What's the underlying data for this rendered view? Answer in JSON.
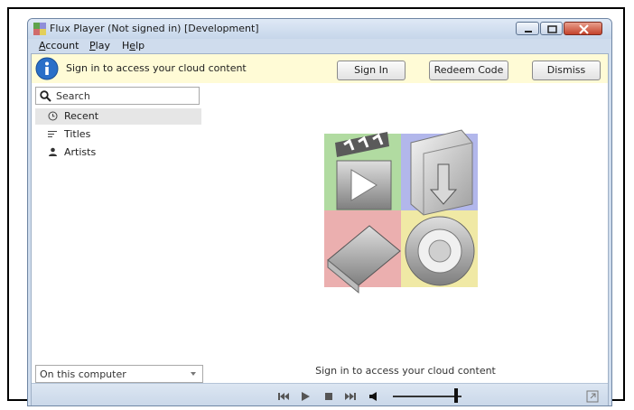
{
  "window": {
    "title": "Flux Player (Not signed in) [Development]"
  },
  "menu": {
    "items": [
      {
        "pre": "",
        "ul": "A",
        "post": "ccount"
      },
      {
        "pre": "",
        "ul": "P",
        "post": "lay"
      },
      {
        "pre": "H",
        "ul": "e",
        "post": "lp"
      }
    ]
  },
  "infobar": {
    "message": "Sign in to access your cloud content",
    "sign_in_label": "Sign In",
    "redeem_label": "Redeem Code",
    "dismiss_label": "Dismiss"
  },
  "sidebar": {
    "search_placeholder": "Search",
    "items": [
      {
        "label": "Recent",
        "icon": "clock-icon",
        "selected": true
      },
      {
        "label": "Titles",
        "icon": "list-icon",
        "selected": false
      },
      {
        "label": "Artists",
        "icon": "person-icon",
        "selected": false
      }
    ],
    "location_select_value": "On this computer"
  },
  "main": {
    "empty_caption": "Sign in to access your cloud content"
  },
  "player": {
    "volume_fraction": 0.92
  }
}
